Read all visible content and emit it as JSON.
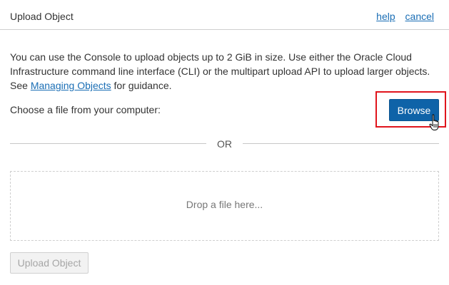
{
  "dialog": {
    "title": "Upload Object",
    "links": {
      "help": "help",
      "cancel": "cancel"
    }
  },
  "description": {
    "text_before": "You can use the Console to upload objects up to 2 GiB in size. Use either the Oracle Cloud Infrastructure command line interface (CLI) or the multipart upload API to upload larger objects. See ",
    "link": "Managing Objects",
    "text_after": " for guidance."
  },
  "file_chooser": {
    "label": "Choose a file from your computer:",
    "browse_label": "Browse"
  },
  "separator": {
    "text": "OR"
  },
  "dropzone": {
    "text": "Drop a file here..."
  },
  "footer": {
    "upload_label": "Upload Object"
  },
  "colors": {
    "primary": "#0f63a8",
    "link": "#1a6eb5",
    "highlight": "#e0141c",
    "disabled_bg": "#f2f2f2"
  },
  "icons": {
    "cursor": "hand-pointer-icon"
  }
}
